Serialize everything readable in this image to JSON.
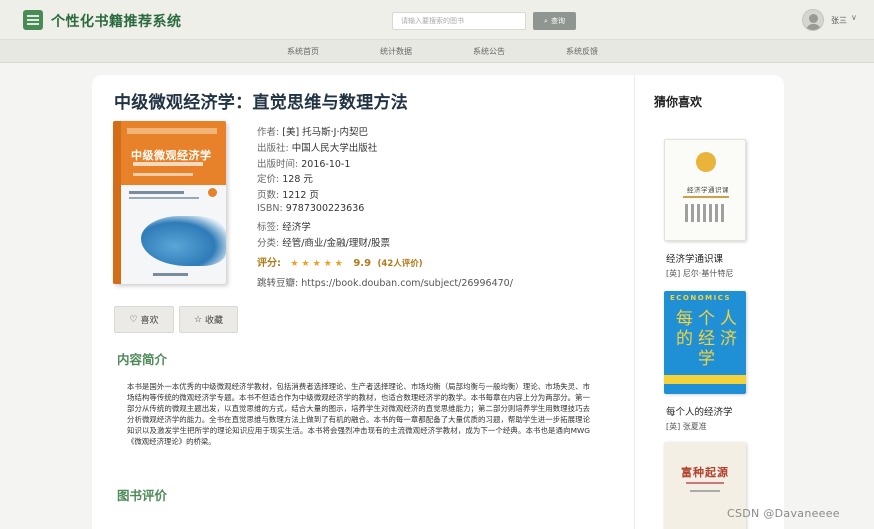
{
  "header": {
    "app_title": "个性化书籍推荐系统",
    "search_placeholder": "请输入要搜索的图书",
    "search_label": "查询",
    "user_name": "张三",
    "user_caret": "∨"
  },
  "nav": {
    "items": [
      {
        "label": "系统首页"
      },
      {
        "label": "统计数据"
      },
      {
        "label": "系统公告"
      },
      {
        "label": "系统反馈"
      }
    ]
  },
  "book": {
    "title": "中级微观经济学：直觉思维与数理方法",
    "cover_title": "中级微观经济学",
    "meta": [
      {
        "key": "作者:",
        "value": "[美] 托马斯·J·内契巴"
      },
      {
        "key": "出版社:",
        "value": "中国人民大学出版社"
      },
      {
        "key": "出版时间:",
        "value": "2016-10-1"
      },
      {
        "key": "定价:",
        "value": "128 元"
      },
      {
        "key": "页数:",
        "value": "1212 页"
      },
      {
        "key": "ISBN:",
        "value": "9787300223636"
      },
      {
        "key": "标签:",
        "value": "经济学"
      },
      {
        "key": "分类:",
        "value": "经管/商业/金融/理财/股票"
      }
    ],
    "rating_label": "评分:",
    "stars": "★★★★★",
    "rating_value": "9.9",
    "rating_count": "(42人评价)",
    "douban_label": "跳转豆瓣:",
    "douban_url": "https://book.douban.com/subject/26996470/",
    "like_label": "喜欢",
    "favorite_label": "收藏",
    "intro_title": "内容简介",
    "intro_text": "本书是国外一本优秀的中级微观经济学教材，包括消费者选择理论、生产者选择理论、市场均衡（局部均衡与一般均衡）理论、市场失灵、市场结构等传统的微观经济学专题。本书不但适合作为中级微观经济学的教材，也适合数理经济学的教学。本书每章在内容上分为两部分。第一部分从传统的微观主题出发，以直觉思维的方式，结合大量的图示，培养学生对微观经济的直觉思维能力；第二部分则培养学生用数理技巧去分析微观经济学的能力。全书在直觉思维与数理方法上做到了有机的融合。本书的每一章都配备了大量优质的习题，帮助学生进一步拓展理论知识以及激发学生把所学的理论知识应用于现实生活。本书将会强烈冲击现有的主流微观经济学教材，成为下一个经典。本书也是通向MWG《微观经济理论》的桥梁。",
    "review_title": "图书评价"
  },
  "sidebar": {
    "title": "猜你喜欢",
    "items": [
      {
        "name": "经济学通识课",
        "author": "[英] 尼尔·基什特尼",
        "cover_text": "经济学通识课"
      },
      {
        "name": "每个人的经济学",
        "author": "[英] 张夏准",
        "cover_eco": "ECONOMICS",
        "cover_big": "每个人的经济学"
      },
      {
        "name": "",
        "author": "",
        "cover_text": "富种起源"
      }
    ]
  },
  "watermark": "CSDN @Davaneeee",
  "colors": {
    "brand_green": "#2b6a3f",
    "section_green": "#4f8a5a",
    "star": "#f0a020"
  }
}
